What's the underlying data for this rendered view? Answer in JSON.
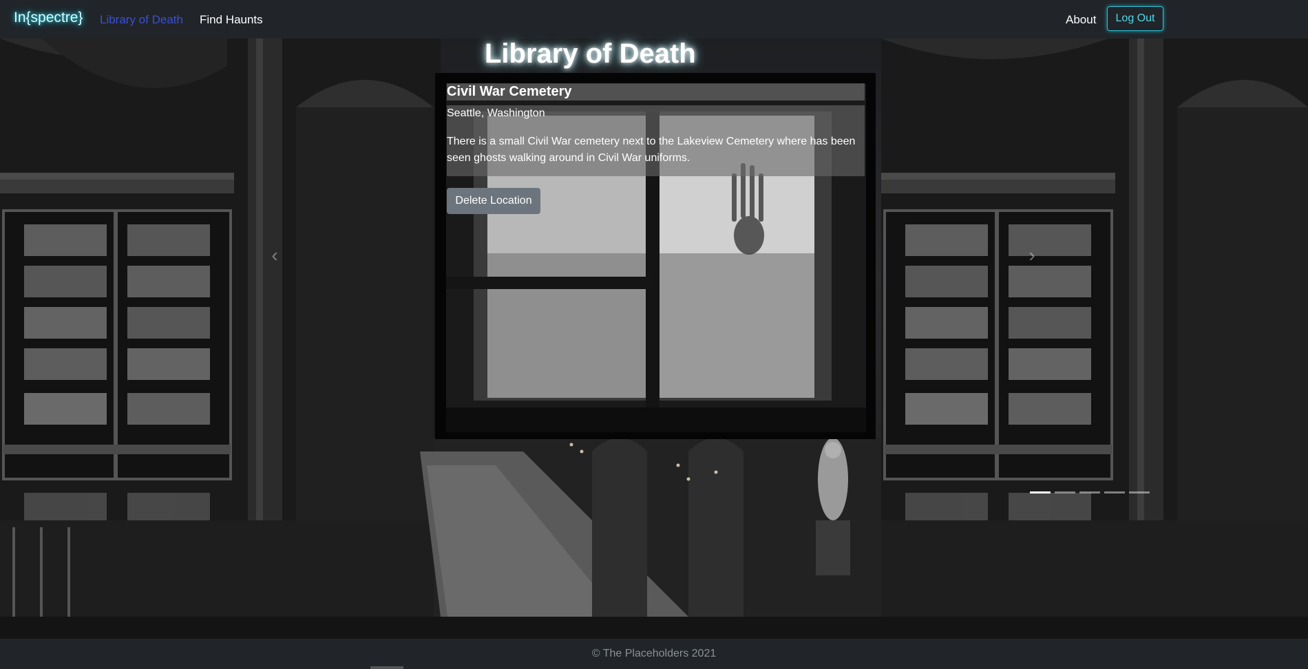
{
  "navbar": {
    "brand": "In{spectre}",
    "links": [
      {
        "label": "Library of Death",
        "active": true
      },
      {
        "label": "Find Haunts",
        "active": false
      }
    ],
    "about": "About",
    "logout": "Log Out"
  },
  "page": {
    "heading": "Library of Death"
  },
  "carousel": {
    "title": "Civil War Cemetery",
    "location": "Seattle, Washington",
    "description": "There is a small Civil War cemetery next to the Lakeview Cemetery where has been seen ghosts walking around in Civil War uniforms.",
    "delete_label": "Delete Location",
    "slide_count": 5,
    "active_index": 0
  },
  "footer": {
    "text": "© The Placeholders 2021"
  },
  "colors": {
    "brand_glow": "#29d3e6",
    "active_link": "#3a4fd6",
    "navbar": "#212529",
    "button_gray": "#6c757d"
  }
}
